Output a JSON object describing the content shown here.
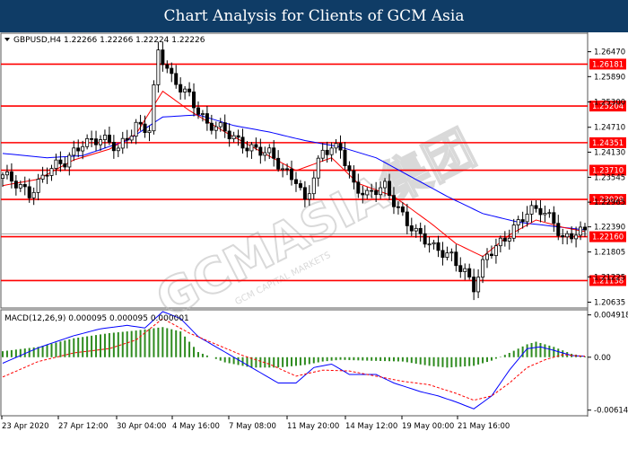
{
  "header": {
    "title": "Chart Analysis for Clients of GCM Asia"
  },
  "watermark": {
    "text": "GCMASIA集团",
    "subtext": "GCM CAPITAL MARKETS"
  },
  "colors": {
    "banner": "#0f3c66",
    "resistance_line": "#ff0000",
    "ma_fast": "#ff0000",
    "ma_slow": "#0000ff",
    "macd_hist": "#2e8b1f",
    "macd_main": "#0000ff",
    "macd_signal": "#ff0000",
    "candle": "#000000"
  },
  "chart_data": [
    {
      "type": "candlestick",
      "symbol_info": "GBPUSD,H4  1.22266 1.22266 1.22224 1.22226",
      "ylim": [
        1.2052,
        1.2688
      ],
      "price_ticks": [
        "1.26470",
        "1.25890",
        "1.25300",
        "1.24710",
        "1.24130",
        "1.23545",
        "1.22965",
        "1.22390",
        "1.21805",
        "1.21225",
        "1.20635"
      ],
      "levels": [
        {
          "value": 1.26181,
          "label": "1.26181"
        },
        {
          "value": 1.25204,
          "label": "1.25204"
        },
        {
          "value": 1.24351,
          "label": "1.24351"
        },
        {
          "value": 1.2371,
          "label": "1.23710"
        },
        {
          "value": 1.23029,
          "label": "1.23029"
        },
        {
          "value": 1.2216,
          "label": "1.22160"
        },
        {
          "value": 1.21138,
          "label": "1.21138"
        }
      ],
      "current_price": {
        "value": 1.22226
      },
      "x_labels": [
        "23 Apr 2020",
        "27 Apr 12:00",
        "30 Apr 04:00",
        "4 May 16:00",
        "7 May 08:00",
        "11 May 20:00",
        "14 May 12:00",
        "19 May 00:00",
        "21 May 16:00"
      ],
      "anchors": [
        [
          0,
          1.2355
        ],
        [
          6,
          1.232
        ],
        [
          10,
          1.237
        ],
        [
          14,
          1.2385
        ],
        [
          18,
          1.244
        ],
        [
          22,
          1.2445
        ],
        [
          26,
          1.2415
        ],
        [
          30,
          1.248
        ],
        [
          33,
          1.247
        ],
        [
          35,
          1.2645
        ],
        [
          38,
          1.258
        ],
        [
          42,
          1.255
        ],
        [
          46,
          1.2475
        ],
        [
          50,
          1.246
        ],
        [
          55,
          1.243
        ],
        [
          60,
          1.2405
        ],
        [
          63,
          1.237
        ],
        [
          66,
          1.2355
        ],
        [
          68,
          1.23
        ],
        [
          72,
          1.241
        ],
        [
          76,
          1.2425
        ],
        [
          79,
          1.234
        ],
        [
          82,
          1.231
        ],
        [
          86,
          1.233
        ],
        [
          90,
          1.227
        ],
        [
          93,
          1.2225
        ],
        [
          97,
          1.2185
        ],
        [
          101,
          1.2175
        ],
        [
          104,
          1.2135
        ],
        [
          106,
          1.2095
        ],
        [
          109,
          1.217
        ],
        [
          112,
          1.2205
        ],
        [
          115,
          1.224
        ],
        [
          118,
          1.227
        ],
        [
          121,
          1.2275
        ],
        [
          124,
          1.2255
        ],
        [
          126,
          1.2215
        ],
        [
          129,
          1.2225
        ],
        [
          131,
          1.2222
        ]
      ],
      "ma_slow": [
        [
          0,
          1.241
        ],
        [
          10,
          1.24
        ],
        [
          18,
          1.2405
        ],
        [
          28,
          1.244
        ],
        [
          36,
          1.2495
        ],
        [
          44,
          1.25
        ],
        [
          52,
          1.2475
        ],
        [
          60,
          1.246
        ],
        [
          68,
          1.244
        ],
        [
          76,
          1.2425
        ],
        [
          84,
          1.24
        ],
        [
          92,
          1.2355
        ],
        [
          100,
          1.231
        ],
        [
          108,
          1.227
        ],
        [
          116,
          1.225
        ],
        [
          124,
          1.224
        ],
        [
          131,
          1.2232
        ]
      ],
      "ma_fast": [
        [
          0,
          1.2335
        ],
        [
          8,
          1.235
        ],
        [
          16,
          1.2395
        ],
        [
          24,
          1.242
        ],
        [
          30,
          1.2455
        ],
        [
          36,
          1.2555
        ],
        [
          42,
          1.251
        ],
        [
          50,
          1.246
        ],
        [
          58,
          1.2415
        ],
        [
          66,
          1.237
        ],
        [
          74,
          1.24
        ],
        [
          80,
          1.234
        ],
        [
          88,
          1.231
        ],
        [
          96,
          1.225
        ],
        [
          102,
          1.22
        ],
        [
          108,
          1.217
        ],
        [
          114,
          1.222
        ],
        [
          120,
          1.2255
        ],
        [
          126,
          1.2238
        ],
        [
          131,
          1.2228
        ]
      ]
    },
    {
      "type": "macd",
      "label": "MACD(12,26,9) 0.000095 0.000095 0.000001",
      "ylim": [
        -0.0067,
        0.0053
      ],
      "ticks": [
        {
          "value": 0.004918,
          "label": "0.004918"
        },
        {
          "value": 0.0,
          "label": "0.00"
        },
        {
          "value": -0.006149,
          "label": "-0.006149"
        }
      ],
      "hist": [
        [
          0,
          0.0007
        ],
        [
          8,
          0.0012
        ],
        [
          16,
          0.0022
        ],
        [
          24,
          0.0028
        ],
        [
          30,
          0.0031
        ],
        [
          36,
          0.0035
        ],
        [
          40,
          0.003
        ],
        [
          44,
          0.0006
        ],
        [
          50,
          -0.0006
        ],
        [
          56,
          -0.0012
        ],
        [
          62,
          -0.0012
        ],
        [
          68,
          -0.0009
        ],
        [
          72,
          -0.0005
        ],
        [
          76,
          -0.0003
        ],
        [
          82,
          -0.0004
        ],
        [
          90,
          -0.0005
        ],
        [
          96,
          -0.001
        ],
        [
          100,
          -0.0012
        ],
        [
          106,
          -0.001
        ],
        [
          110,
          -0.0004
        ],
        [
          114,
          0.0005
        ],
        [
          118,
          0.0015
        ],
        [
          120,
          0.0018
        ],
        [
          124,
          0.0012
        ],
        [
          128,
          0.0004
        ],
        [
          131,
          0.0001
        ]
      ],
      "main": [
        [
          0,
          -0.0007
        ],
        [
          8,
          0.0011
        ],
        [
          16,
          0.0025
        ],
        [
          22,
          0.0033
        ],
        [
          28,
          0.0037
        ],
        [
          32,
          0.0034
        ],
        [
          36,
          0.0053
        ],
        [
          40,
          0.0045
        ],
        [
          44,
          0.0024
        ],
        [
          50,
          0.0006
        ],
        [
          56,
          -0.0012
        ],
        [
          62,
          -0.003
        ],
        [
          66,
          -0.003
        ],
        [
          70,
          -0.0012
        ],
        [
          74,
          -0.0008
        ],
        [
          78,
          -0.002
        ],
        [
          84,
          -0.002
        ],
        [
          88,
          -0.003
        ],
        [
          94,
          -0.004
        ],
        [
          98,
          -0.0045
        ],
        [
          102,
          -0.0052
        ],
        [
          106,
          -0.006
        ],
        [
          110,
          -0.0045
        ],
        [
          114,
          -0.0015
        ],
        [
          118,
          0.001
        ],
        [
          121,
          0.0012
        ],
        [
          124,
          0.0008
        ],
        [
          128,
          0.0002
        ],
        [
          131,
          0.0001
        ]
      ],
      "signal": [
        [
          0,
          -0.0023
        ],
        [
          8,
          -0.0005
        ],
        [
          16,
          0.0005
        ],
        [
          24,
          0.001
        ],
        [
          30,
          0.002
        ],
        [
          36,
          0.0045
        ],
        [
          42,
          0.0028
        ],
        [
          48,
          0.0015
        ],
        [
          54,
          0.0002
        ],
        [
          60,
          -0.0008
        ],
        [
          66,
          -0.0022
        ],
        [
          72,
          -0.0015
        ],
        [
          78,
          -0.0016
        ],
        [
          84,
          -0.0022
        ],
        [
          90,
          -0.0028
        ],
        [
          96,
          -0.0032
        ],
        [
          102,
          -0.0042
        ],
        [
          106,
          -0.005
        ],
        [
          110,
          -0.0045
        ],
        [
          114,
          -0.003
        ],
        [
          118,
          -0.0012
        ],
        [
          122,
          -0.0003
        ],
        [
          126,
          0.0003
        ],
        [
          131,
          0.0001
        ]
      ]
    }
  ]
}
